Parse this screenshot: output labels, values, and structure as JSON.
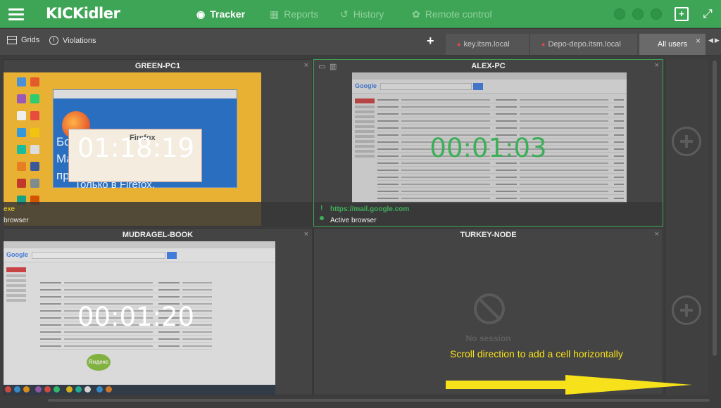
{
  "app": {
    "logo": "KICKidler",
    "nav": [
      {
        "label": "Tracker",
        "icon": "eye-icon"
      },
      {
        "label": "Reports",
        "icon": "chart-icon"
      },
      {
        "label": "History",
        "icon": "history-icon"
      },
      {
        "label": "Remote control",
        "icon": "remote-icon"
      }
    ]
  },
  "toolbar": {
    "grids_label": "Grids",
    "violations_label": "Violations",
    "add_tab_label": "+",
    "tabs": [
      {
        "label": "key.itsm.local"
      },
      {
        "label": "Depo-depo.itsm.local"
      },
      {
        "label": "All users"
      }
    ],
    "close_label": "×",
    "scroll_arrows": "◀▶"
  },
  "cells": [
    {
      "title": "GREEN-PC1",
      "timer": "01:18:19",
      "process": "exe",
      "status": "browser",
      "screen_text": {
        "brand": "Firefox",
        "body": [
          "Бол",
          "Ма",
          "пр",
          "Только в Firefox."
        ]
      }
    },
    {
      "title": "ALEX-PC",
      "timer": "00:01:03",
      "url": "https://mail.google.com",
      "status": "Active browser",
      "screen_text": {
        "logo": "Google"
      }
    },
    {
      "title": "MUDRAGEL-BOOK",
      "timer": "00:01:20",
      "screen_text": {
        "logo": "Google",
        "badge": "Яндекс"
      }
    },
    {
      "title": "TURKEY-NODE",
      "no_session": "No session"
    }
  ],
  "annotation": "Scroll direction to add a cell horizontally",
  "colors": {
    "brand": "#3fa556",
    "annotation": "#f7e11a",
    "green_timer": "#3fae59"
  }
}
